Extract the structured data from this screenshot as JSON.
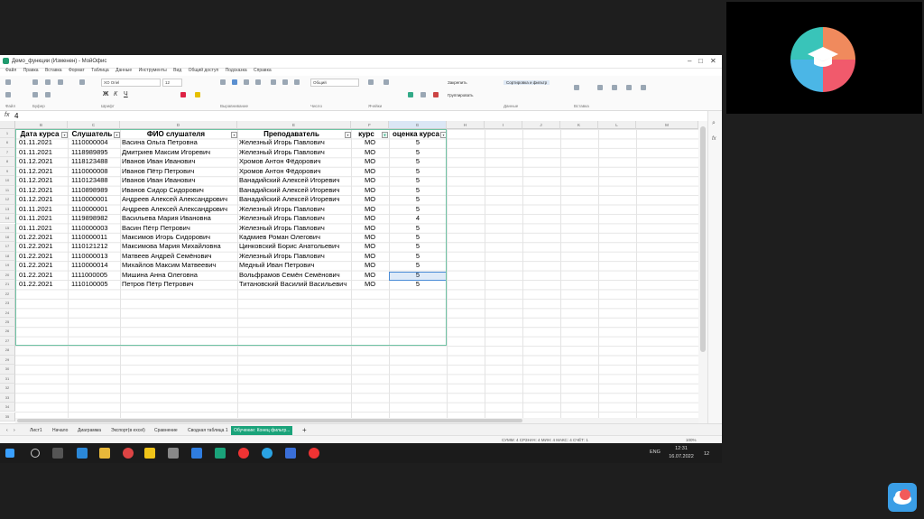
{
  "window": {
    "title": "Демо_функции (Изменен) - МойОфис",
    "formula_value": "4",
    "formula_prefix": "fx"
  },
  "menu": [
    "Файл",
    "Правка",
    "Вставка",
    "Формат",
    "Таблица",
    "Данные",
    "Инструменты",
    "Вид",
    "Общий доступ",
    "Подсказка",
    "Справка"
  ],
  "ribbon": {
    "font_name": "XO Oriel",
    "font_size": "12",
    "number_format": "Общий",
    "freeze_label": "Закрепить",
    "group_label": "Группировать",
    "sort_label": "Сортировка и фильтр",
    "groups": [
      "Файл",
      "Буфер",
      "Шрифт",
      "Выравнивание",
      "Число",
      "Ячейки",
      "Данные",
      "Вставка"
    ]
  },
  "columns": [
    "B",
    "C",
    "D",
    "E",
    "F",
    "G",
    "H",
    "I",
    "J",
    "K",
    "L",
    "M"
  ],
  "header_row": [
    "Дата курса",
    "Слушатель",
    "ФИО слушателя",
    "Преподаватель",
    "курс",
    "оценка курса"
  ],
  "row_numbers": [
    "1",
    "6",
    "7",
    "8",
    "9",
    "10",
    "11",
    "12",
    "13",
    "14",
    "15",
    "16",
    "17",
    "18",
    "19",
    "20",
    "21",
    "22",
    "23",
    "24",
    "25",
    "26",
    "27",
    "28",
    "29",
    "30",
    "31",
    "32",
    "33",
    "34",
    "35"
  ],
  "rows": [
    {
      "date": "01.11.2021",
      "id": "1110000004",
      "fio": "Васина Ольга Петровна",
      "teacher": "Железный Игорь Павлович",
      "course": "МО",
      "grade": "5"
    },
    {
      "date": "01.11.2021",
      "id": "1118989895",
      "fio": "Дмитриев Максим Игоревич",
      "teacher": "Железный Игорь Павлович",
      "course": "МО",
      "grade": "5"
    },
    {
      "date": "01.12.2021",
      "id": "1118123488",
      "fio": "Иванов Иван Иванович",
      "teacher": "Хромов Антон Фёдорович",
      "course": "МО",
      "grade": "5"
    },
    {
      "date": "01.12.2021",
      "id": "1110000008",
      "fio": "Иванов Пётр Петрович",
      "teacher": "Хромов Антон Фёдорович",
      "course": "МО",
      "grade": "5"
    },
    {
      "date": "01.12.2021",
      "id": "1110123488",
      "fio": "Иванов Иван Иванович",
      "teacher": "Ванадийский Алексей Игоревич",
      "course": "МО",
      "grade": "5"
    },
    {
      "date": "01.12.2021",
      "id": "1110898989",
      "fio": "Иванов Сидор Сидорович",
      "teacher": "Ванадийский Алексей Игоревич",
      "course": "МО",
      "grade": "5"
    },
    {
      "date": "01.12.2021",
      "id": "1110000001",
      "fio": "Андреев Алексей Александрович",
      "teacher": "Ванадийский Алексей Игоревич",
      "course": "МО",
      "grade": "5"
    },
    {
      "date": "01.11.2021",
      "id": "1110000001",
      "fio": "Андреев Алексей Александрович",
      "teacher": "Железный Игорь Павлович",
      "course": "МО",
      "grade": "5"
    },
    {
      "date": "01.11.2021",
      "id": "1119898982",
      "fio": "Васильева Мария Ивановна",
      "teacher": "Железный Игорь Павлович",
      "course": "МО",
      "grade": "4"
    },
    {
      "date": "01.11.2021",
      "id": "1110000003",
      "fio": "Васин Пётр Петрович",
      "teacher": "Железный Игорь Павлович",
      "course": "МО",
      "grade": "5"
    },
    {
      "date": "01.22.2021",
      "id": "1110000011",
      "fio": "Максимов Игорь Сидорович",
      "teacher": "Кадмиев Роман Олегович",
      "course": "МО",
      "grade": "5"
    },
    {
      "date": "01.22.2021",
      "id": "1110121212",
      "fio": "Максимова Мария Михайловна",
      "teacher": "Цинковский Борис Анатольевич",
      "course": "МО",
      "grade": "5"
    },
    {
      "date": "01.22.2021",
      "id": "1110000013",
      "fio": "Матвеев Андрей Семёнович",
      "teacher": "Железный Игорь Павлович",
      "course": "МО",
      "grade": "5"
    },
    {
      "date": "01.22.2021",
      "id": "1110000014",
      "fio": "Михайлов Максим Матвеевич",
      "teacher": "Медный Иван Петрович",
      "course": "МО",
      "grade": "5"
    },
    {
      "date": "01.22.2021",
      "id": "1111000005",
      "fio": "Мишина Анна Олеговна",
      "teacher": "Вольфрамов Семён Семёнович",
      "course": "МО",
      "grade": "5"
    },
    {
      "date": "01.22.2021",
      "id": "1110100005",
      "fio": "Петров Пётр Петрович",
      "teacher": "Титановский Василий Васильевич",
      "course": "МО",
      "grade": "5"
    }
  ],
  "sheet_tabs": [
    "Лист1",
    "Начало",
    "Диаграмма",
    "Экспорт(в excel)",
    "Сравнение",
    "Сводная таблица 1",
    "Обучение: Конец фильтр..."
  ],
  "status": {
    "summary": "СУММ: 4   СРЗНАЧ: 4   МИН: 4   МАКС: 4   СЧЁТ: 1",
    "zoom": "100%"
  },
  "taskbar": {
    "lang": "ENG",
    "time": "12:31",
    "date": "16.07.2022",
    "notif": "12"
  },
  "colors": {
    "accent": "#1aa37a",
    "selection": "#4a8bd6"
  }
}
